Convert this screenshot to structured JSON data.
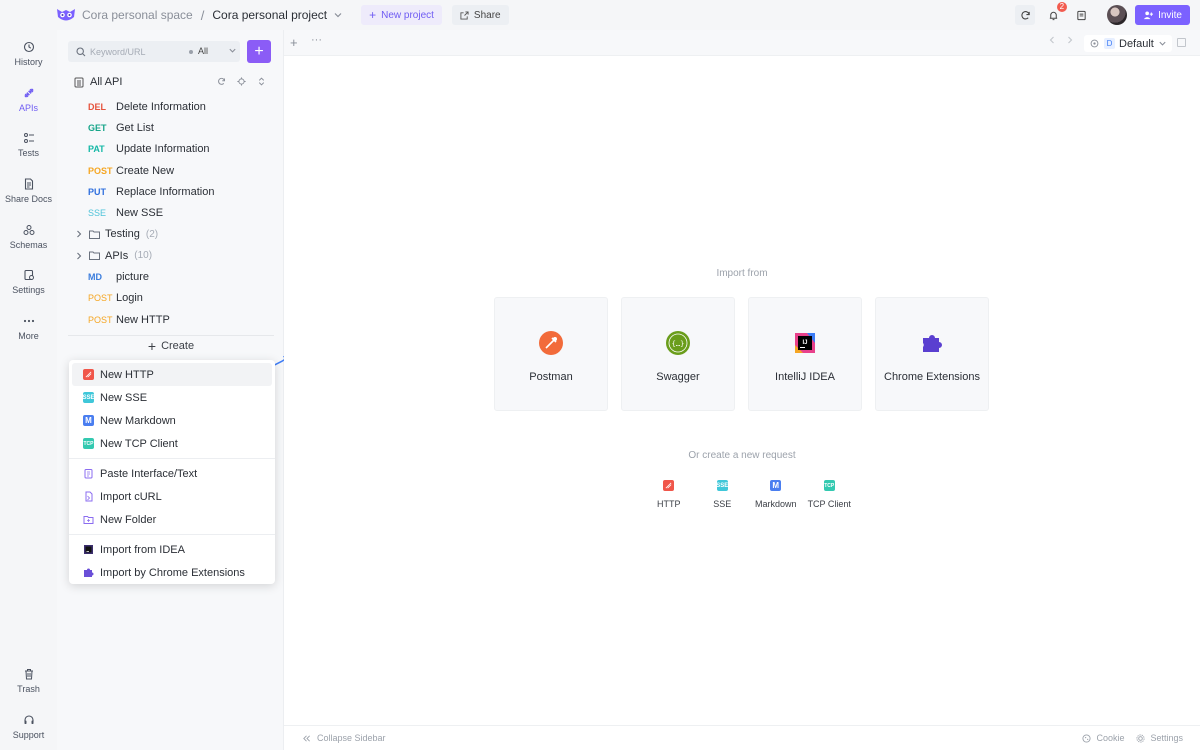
{
  "topbar": {
    "space": "Cora personal space",
    "separator": "/",
    "project": "Cora personal project",
    "new_project": "New project",
    "share": "Share",
    "notification_count": "2",
    "invite": "Invite"
  },
  "nav": {
    "items": [
      {
        "label": "History",
        "icon": "history-icon"
      },
      {
        "label": "APIs",
        "icon": "apis-icon"
      },
      {
        "label": "Tests",
        "icon": "tests-icon"
      },
      {
        "label": "Share Docs",
        "icon": "share-docs-icon"
      },
      {
        "label": "Schemas",
        "icon": "schemas-icon"
      },
      {
        "label": "Settings",
        "icon": "settings-icon"
      },
      {
        "label": "More",
        "icon": "more-icon"
      }
    ],
    "bottom": [
      {
        "label": "Trash",
        "icon": "trash-icon"
      },
      {
        "label": "Support",
        "icon": "support-icon"
      }
    ]
  },
  "sidebar": {
    "search_placeholder": "Keyword/URL",
    "scope": "All",
    "all_api": "All API",
    "tree": [
      {
        "method": "DEL",
        "name": "Delete Information",
        "color": "#e5533d"
      },
      {
        "method": "GET",
        "name": "Get List",
        "color": "#17a589"
      },
      {
        "method": "PAT",
        "name": "Update Information",
        "color": "#14b8a6"
      },
      {
        "method": "POST",
        "name": "Create New",
        "color": "#f5a623"
      },
      {
        "method": "PUT",
        "name": "Replace Information",
        "color": "#2f6fde"
      },
      {
        "method": "SSE",
        "name": "New SSE",
        "color": "#4fc3d9"
      },
      {
        "folder": true,
        "name": "Testing",
        "count": "(2)"
      },
      {
        "folder": true,
        "name": "APIs",
        "count": "(10)"
      },
      {
        "method": "MD",
        "name": "picture",
        "color": "#3b7ddd"
      },
      {
        "method": "POST",
        "name": "Login",
        "color": "#f5a623"
      },
      {
        "method": "POST",
        "name": "New HTTP",
        "color": "#f5a623"
      }
    ],
    "create": "Create"
  },
  "menu": {
    "groups": [
      [
        {
          "label": "New HTTP",
          "icon": "http-icon",
          "color": "#f0564a",
          "highlight": true
        },
        {
          "label": "New SSE",
          "icon": "sse-icon",
          "color": "#3fc7d9",
          "tag": "SSE"
        },
        {
          "label": "New Markdown",
          "icon": "markdown-icon",
          "color": "#4a7ef0",
          "tag": "M"
        },
        {
          "label": "New TCP Client",
          "icon": "tcp-icon",
          "color": "#33c9b0",
          "tag": "TCP"
        }
      ],
      [
        {
          "label": "Paste Interface/Text",
          "icon": "paste-icon",
          "color": "#8b6cf0"
        },
        {
          "label": "Import cURL",
          "icon": "curl-icon",
          "color": "#8b6cf0"
        },
        {
          "label": "New Folder",
          "icon": "folder-icon",
          "color": "#8b6cf0"
        }
      ],
      [
        {
          "label": "Import from IDEA",
          "icon": "idea-icon",
          "color": "#1f1f1f"
        },
        {
          "label": "Import by Chrome Extensions",
          "icon": "puzzle-icon",
          "color": "#6a4fd8"
        }
      ]
    ]
  },
  "main": {
    "env": "Default",
    "env_badge": "D",
    "import_from": "Import from",
    "cards": [
      {
        "label": "Postman",
        "icon": "postman-icon"
      },
      {
        "label": "Swagger",
        "icon": "swagger-icon"
      },
      {
        "label": "IntelliJ IDEA",
        "icon": "intellij-icon"
      },
      {
        "label": "Chrome Extensions",
        "icon": "chrome-extensions-icon"
      }
    ],
    "or_create": "Or create a new request",
    "quick": [
      {
        "label": "HTTP",
        "color": "#f0564a"
      },
      {
        "label": "SSE",
        "color": "#3fc7d9",
        "tag": "SSE"
      },
      {
        "label": "Markdown",
        "color": "#4a7ef0",
        "tag": "M"
      },
      {
        "label": "TCP Client",
        "color": "#33c9b0",
        "tag": "TCP"
      }
    ],
    "collapse": "Collapse Sidebar",
    "cookie": "Cookie",
    "settings": "Settings"
  }
}
